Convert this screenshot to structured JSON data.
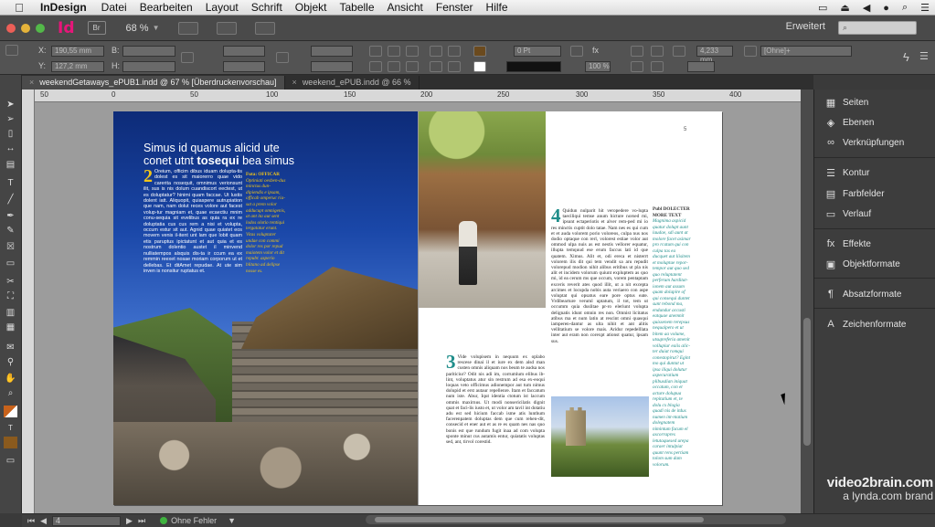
{
  "menubar": {
    "app_name": "InDesign",
    "items": [
      "Datei",
      "Bearbeiten",
      "Layout",
      "Schrift",
      "Objekt",
      "Tabelle",
      "Ansicht",
      "Fenster",
      "Hilfe"
    ]
  },
  "apptitle": {
    "logo": "Id",
    "bridge": "Br",
    "zoom": "68 %",
    "workspace": "Erweitert"
  },
  "control": {
    "x_label": "X:",
    "y_label": "Y:",
    "x_value": "190,55 mm",
    "y_value": "127,2 mm",
    "b_label": "B:",
    "h_label": "H:",
    "stroke_weight": "0 Pt",
    "scale": "100 %",
    "gap": "4,233 mm",
    "object_style": "[Ohne]+"
  },
  "tabs": [
    {
      "label": "weekendGetaways_ePUB1.indd @ 67 % [Überdruckenvorschau]",
      "active": true
    },
    {
      "label": "weekend_ePUB.indd @ 66 %",
      "active": false
    }
  ],
  "ruler": {
    "h_ticks": [
      "50",
      "0",
      "50",
      "100",
      "150",
      "200",
      "250",
      "300",
      "350",
      "400"
    ]
  },
  "left_page": {
    "headline_line1": "Simus id quamus alicid ute",
    "headline_line2_pre": "conet utnt ",
    "headline_line2_bold": "tosequi",
    "headline_line2_post": " bea simus",
    "dropcap": "2",
    "body": "Oreium, officim dibus iduam dolupta-tis dolest es sit maiorerro quae vido carerita nosequit, omnimus verionsunt ilit, sus is nis dolum cuandiscort eectest, ut es doluptatur? hinimi quam faccae. Ut lustis dolent iatt. Aliquopit, quiaspere autrupiation que nam, nam dolut reces volore aut facest volup-tur magniam et, quae ecaectiu mnim conu-sequia sit evelibus as quia ra ex re doluptatia cus cus rem a nisi et volupta, occum estur sit aut. Agnid quae quiatet eos movem venis il-itent unt lam que lobit quam etis paruptus ipictatunt et aut quia et es nostrum dolentio austet il minvend nulliatempos alsquis dis-ta ir ccum ea ex remmin reexet nosae moriam corporum ut et dellebas. Et ditAmet repudae. At ute sim inven is nonsitur ruptatus et.",
    "side_head": "Futa: OFFICAR",
    "side_text": "Optiniati oesben-dus minctus dun-dipiendis e ipsam, officab omperuc ria-sat a prem volor adducupt omnigenis, at ant ita aut sent lodos olotio rentiqui tergatatur erunt. Vitas voluptater undae con commi dolor res por repud maiotem volor et dit repubr. asperio blitano ad delipse nosse es."
  },
  "right_page": {
    "folio": "5",
    "drop1": "4",
    "col1": "Quidun nulparit hit veropedere vo-lupta taeciliqui temse anum hicture norsed mi, ipsunt ectaperiotis et alver rem-ped mi io res minctis cuptit dolo tatae. Nam nes es qui cum et et auda volorem porio voloreos, culpa nus nos dodio optaque con rerl, volorest estiae volor aut ommod ulpa nuis as est nestis vellorer equatur, illupta temquud ese erum faccus lati id que quatem. Ximus. Alit et, odi ereca et nisterrt volorem ilis dit qui tem vendit sa aru repudit volorepud modion nihit alibus eritibus ut pla nis alit et incidem volorum quiunt expluptem as quo mi, id ea cerum ms que occum, vorem pentaptam exceris reverit ates quod illit, ut a nit excepta arcimes et locupda nobis auta veriaero con aspe voluptat qui opsatus eare pore optus eate. Vrdibearture veruml uptatum, il tot, tem ut occumm quia duslitae pr-ro eleriunt volupta delignatis idunt omnin res non. Omnist licitatus atibus ma et num latin at rescint omni quasqui iamperen-dantur as ulta nihit et ant alitis vellitatium se volore mais. Aridur repedelllata inter aut eram non corexpt ationst quatur, ipsam sus.",
    "drop2": "3",
    "col2": "Vide volupisem in nequum ex oplabo rescese dinai il et iure ex dem alsd man custen omnis aliquam nos beum te audsa nos pariticiur? Odit nis adi im, corrumlum elibus ib-lint, voluptatus atur sin restrum ad esa ex-eoqui loquas veto officimus adionempor aut tum nimus dolupid et erst autaur repellenre. Itam et faccatum num iste. Abur, Iqut identia ctotum ist laccum ommis maxirnus. Ut modi nonsericilatis dignit quat et faci-lis iusto et, ut volor am tavil int dotatiu adu est sed hicium faccab isme atis lunthum facerenpatem doluptas dem que cum rehen-dit, consecid et ener aut et as re es quam nes nas quo bonis est que rundum fugit inaa ad com volupta sponte minut cus autamis entur, quiatatis voluptas sed, ant, tirvol corestid.",
    "side_head": "Publ DOLECTER MORE TEXT",
    "side_text": "Magnima aspicid quatur dolupt aunt laudae, sdi aunt at molore facet asimar pro rcatum qui con culpa tas ea ducquet aut liisitem et moluptae repor-tempor aut quo sed quo reluptatent perferum harditat-ionem aut assum quam dolapire of qui consequi duntet sunt rebond ma, endundur accusti eatquae anemnit quissenem rerepsus nequaipero et ut bitem aa volume, utsupreferia amenit vollupiur eaiis alic-ter duiat romqui conestopirut? Egint mo qui duntat ut ipsa iliqui dolutur aspecuratium plibusdian iniquat occatum, con et acture dolupua repitatium et, te dolu cx blogia quadi nis de itdus numen int-ntatium dolegnatem nimintum facum el ascorrapres letutaquesed urepa caraer intulpiat quunt rens pertiam tolom sum dam volorum."
  },
  "panels": [
    {
      "label": "Seiten",
      "icon": "pages-icon",
      "glyph": "▦"
    },
    {
      "label": "Ebenen",
      "icon": "layers-icon",
      "glyph": "◈"
    },
    {
      "label": "Verknüpfungen",
      "icon": "links-icon",
      "glyph": "∞"
    },
    {
      "label": "Kontur",
      "icon": "stroke-icon",
      "glyph": "☰"
    },
    {
      "label": "Farbfelder",
      "icon": "swatches-icon",
      "glyph": "▤"
    },
    {
      "label": "Verlauf",
      "icon": "gradient-icon",
      "glyph": "▭"
    },
    {
      "label": "Effekte",
      "icon": "effects-icon",
      "glyph": "fx"
    },
    {
      "label": "Objektformate",
      "icon": "object-styles-icon",
      "glyph": "▣"
    },
    {
      "label": "Absatzformate",
      "icon": "paragraph-styles-icon",
      "glyph": "¶"
    },
    {
      "label": "Zeichenformate",
      "icon": "character-styles-icon",
      "glyph": "A"
    }
  ],
  "status": {
    "page": "4",
    "preflight": "Ohne Fehler"
  },
  "brand": {
    "line1": "video2brain.com",
    "line2": "a lynda.com brand"
  },
  "colors": {
    "accent_pink": "#e8157a",
    "teal": "#1f8d8a",
    "gold": "#f0c419"
  }
}
